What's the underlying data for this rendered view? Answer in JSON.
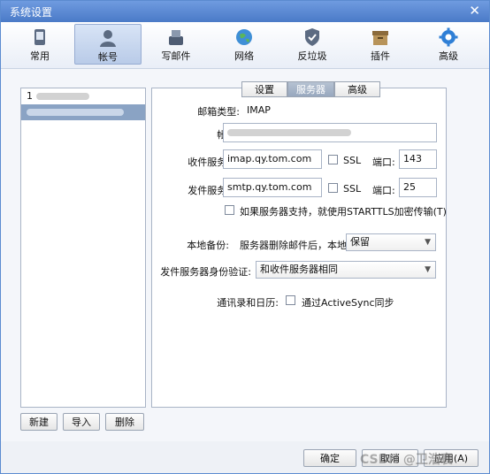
{
  "window": {
    "title": "系统设置"
  },
  "toolbar": [
    {
      "label": "常用",
      "icon": "phone-icon"
    },
    {
      "label": "帐号",
      "icon": "user-icon"
    },
    {
      "label": "写邮件",
      "icon": "compose-icon"
    },
    {
      "label": "网络",
      "icon": "globe-icon"
    },
    {
      "label": "反垃圾",
      "icon": "shield-icon"
    },
    {
      "label": "插件",
      "icon": "box-icon"
    },
    {
      "label": "高级",
      "icon": "gear-icon"
    }
  ],
  "accounts": {
    "items": [
      {
        "label": "1"
      },
      {
        "label": ""
      }
    ],
    "buttons": {
      "new": "新建",
      "import": "导入",
      "delete": "删除"
    }
  },
  "tabs": {
    "settings": "设置",
    "server": "服务器",
    "advanced": "高级"
  },
  "form": {
    "mailbox_type_label": "邮箱类型:",
    "mailbox_type_value": "IMAP",
    "account_label": "帐号:",
    "account_value": "",
    "incoming_label": "收件服务器:",
    "incoming_value": "imap.qy.tom.com",
    "incoming_ssl": "SSL",
    "incoming_port_label": "端口:",
    "incoming_port": "143",
    "outgoing_label": "发件服务器:",
    "outgoing_value": "smtp.qy.tom.com",
    "outgoing_ssl": "SSL",
    "outgoing_port_label": "端口:",
    "outgoing_port": "25",
    "starttls_label": "如果服务器支持，就使用STARTTLS加密传输(T)",
    "backup_label": "本地备份:",
    "backup_desc": "服务器删除邮件后，本地",
    "backup_value": "保留",
    "smtp_auth_label": "发件服务器身份验证:",
    "smtp_auth_value": "和收件服务器相同",
    "contacts_label": "通讯录和日历:",
    "activesync_label": "通过ActiveSync同步"
  },
  "footer": {
    "ok": "确定",
    "cancel": "取消",
    "apply": "应用(A)"
  },
  "watermark": "CSDN @卫浩寰",
  "colors": {
    "titlebar": "#4a7ac7",
    "selected": "#8aa3c4",
    "accent": "#5b8bd0"
  }
}
